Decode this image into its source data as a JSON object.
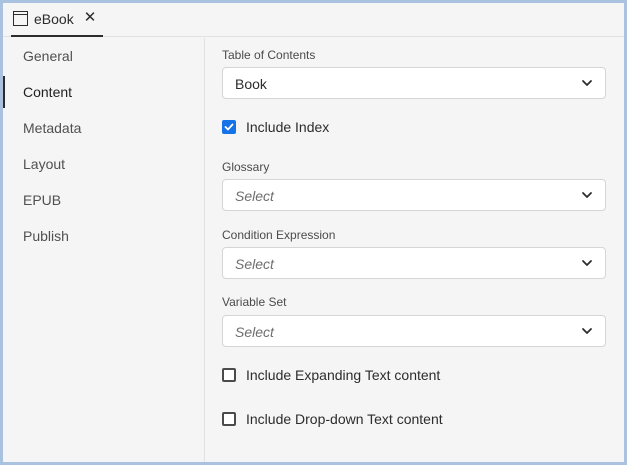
{
  "tab": {
    "label": "eBook",
    "close_glyph": "✕",
    "icon": "window-icon"
  },
  "sidebar": {
    "items": [
      {
        "label": "General"
      },
      {
        "label": "Content"
      },
      {
        "label": "Metadata"
      },
      {
        "label": "Layout"
      },
      {
        "label": "EPUB"
      },
      {
        "label": "Publish"
      }
    ],
    "active": "Content"
  },
  "content": {
    "toc": {
      "label": "Table of Contents",
      "value": "Book"
    },
    "include_index": {
      "label": "Include Index",
      "checked": true
    },
    "glossary": {
      "label": "Glossary",
      "placeholder": "Select"
    },
    "condition": {
      "label": "Condition Expression",
      "placeholder": "Select"
    },
    "variable_set": {
      "label": "Variable Set",
      "placeholder": "Select"
    },
    "expanding_text": {
      "label": "Include Expanding Text content",
      "checked": false
    },
    "dropdown_text": {
      "label": "Include Drop-down Text content",
      "checked": false
    }
  },
  "colors": {
    "accent": "#1473e6",
    "frame": "#a8c2e0",
    "panel": "#f5f5f5"
  }
}
